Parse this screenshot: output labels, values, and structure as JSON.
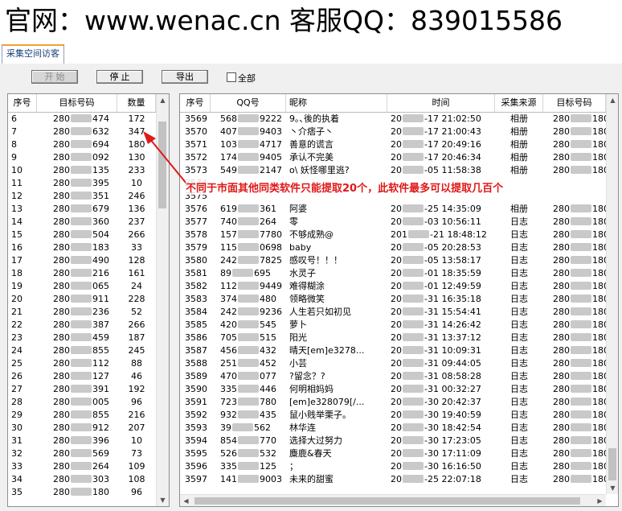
{
  "banner": "官网：www.wenac.cn  客服QQ：839015586",
  "tab_label": "采集空间访客",
  "buttons": {
    "start": "开 始",
    "stop": "停 止",
    "export": "导出"
  },
  "select_all_label": "全部",
  "annotation": "不同于市面其他同类软件只能提取20个，此软件最多可以提取几百个",
  "colors": {
    "annotation": "#e01818",
    "accent": "#f3a032"
  },
  "left_table": {
    "headers": [
      "序号",
      "目标号码",
      "数量"
    ],
    "rows": [
      [
        "6",
        "280|474",
        "172"
      ],
      [
        "7",
        "280|632",
        "347"
      ],
      [
        "8",
        "280|694",
        "180"
      ],
      [
        "9",
        "280|092",
        "130"
      ],
      [
        "10",
        "280|135",
        "233"
      ],
      [
        "11",
        "280|395",
        "10"
      ],
      [
        "12",
        "280|351",
        "246"
      ],
      [
        "13",
        "280|679",
        "136"
      ],
      [
        "14",
        "280|360",
        "237"
      ],
      [
        "15",
        "280|504",
        "266"
      ],
      [
        "16",
        "280|183",
        "33"
      ],
      [
        "17",
        "280|490",
        "128"
      ],
      [
        "18",
        "280|216",
        "161"
      ],
      [
        "19",
        "280|065",
        "24"
      ],
      [
        "20",
        "280|911",
        "228"
      ],
      [
        "21",
        "280|236",
        "52"
      ],
      [
        "22",
        "280|387",
        "266"
      ],
      [
        "23",
        "280|459",
        "187"
      ],
      [
        "24",
        "280|855",
        "245"
      ],
      [
        "25",
        "280|112",
        "88"
      ],
      [
        "26",
        "280|127",
        "46"
      ],
      [
        "27",
        "280|391",
        "192"
      ],
      [
        "28",
        "280|005",
        "96"
      ],
      [
        "29",
        "280|855",
        "216"
      ],
      [
        "30",
        "280|912",
        "207"
      ],
      [
        "31",
        "280|396",
        "10"
      ],
      [
        "32",
        "280|569",
        "73"
      ],
      [
        "33",
        "280|264",
        "109"
      ],
      [
        "34",
        "280|303",
        "108"
      ],
      [
        "35",
        "280|180",
        "96"
      ]
    ]
  },
  "right_table": {
    "headers": [
      "序号",
      "QQ号",
      "昵称",
      "时间",
      "采集来源",
      "目标号码"
    ],
    "rows": [
      [
        "3569",
        "568|9222",
        "9｡､後的执着",
        "20|-17 21:02:50",
        "相册",
        "280|180"
      ],
      [
        "3570",
        "407|9403",
        "丶介痞子丶",
        "20|-17 21:00:43",
        "相册",
        "280|180"
      ],
      [
        "3571",
        "103|4717",
        "善意的谎言",
        "20|-17 20:49:16",
        "相册",
        "280|180"
      ],
      [
        "3572",
        "174|9405",
        "承认不完美",
        "20|-17 20:46:34",
        "相册",
        "280|180"
      ],
      [
        "3573",
        "549|2147",
        "o\\ 妖怪哪里逃?",
        "20|-05 11:58:38",
        "相册",
        "280|180"
      ],
      [
        "3574",
        "",
        "",
        "",
        "",
        ""
      ],
      [
        "3575",
        "",
        "",
        "",
        "",
        ""
      ],
      [
        "3576",
        "619|361",
        "阿婆",
        "20|-25 14:35:09",
        "相册",
        "280|180"
      ],
      [
        "3577",
        "740|264",
        "零",
        "20|-03 10:56:11",
        "日志",
        "280|180"
      ],
      [
        "3578",
        "157|7780",
        "不够成熟@",
        "201|-21 18:48:12",
        "日志",
        "280|180"
      ],
      [
        "3579",
        "115|0698",
        "baby",
        "20|-05 20:28:53",
        "日志",
        "280|180"
      ],
      [
        "3580",
        "242|7825",
        "感叹号！！！",
        "20|-05 13:58:17",
        "日志",
        "280|180"
      ],
      [
        "3581",
        "89|695",
        "水灵子",
        "20|-01 18:35:59",
        "日志",
        "280|180"
      ],
      [
        "3582",
        "112|9449",
        "难得糊涂",
        "20|-01 12:49:59",
        "日志",
        "280|180"
      ],
      [
        "3583",
        "374|480",
        "领略微笑",
        "20|-31 16:35:18",
        "日志",
        "280|180"
      ],
      [
        "3584",
        "242|9236",
        "人生若只如初见",
        "20|-31 15:54:41",
        "日志",
        "280|180"
      ],
      [
        "3585",
        "420|545",
        "萝卜",
        "20|-31 14:26:42",
        "日志",
        "280|180"
      ],
      [
        "3586",
        "705|515",
        "阳光",
        "20|-31 13:37:12",
        "日志",
        "280|180"
      ],
      [
        "3587",
        "456|432",
        "晴天[em]e3278...",
        "20|-31 10:09:31",
        "日志",
        "280|180"
      ],
      [
        "3588",
        "251|452",
        "小芸",
        "20|-31 09:44:05",
        "日志",
        "280|180"
      ],
      [
        "3589",
        "470|077",
        "?留念？?",
        "20|-31 08:58:28",
        "日志",
        "280|180"
      ],
      [
        "3590",
        "335|446",
        "何明相妈妈",
        "20|-31 00:32:27",
        "日志",
        "280|180"
      ],
      [
        "3591",
        "723|780",
        "[em]e328079[/...",
        "20|-30 20:42:37",
        "日志",
        "280|180"
      ],
      [
        "3592",
        "932|435",
        "鼠小贱举栗子。",
        "20|-30 19:40:59",
        "日志",
        "280|180"
      ],
      [
        "3593",
        "39|562",
        "林华连",
        "20|-30 18:42:54",
        "日志",
        "280|180"
      ],
      [
        "3594",
        "854|770",
        "选择大过努力",
        "20|-30 17:23:05",
        "日志",
        "280|180"
      ],
      [
        "3595",
        "526|532",
        "麋鹿&春天",
        "20|-30 17:11:09",
        "日志",
        "280|180"
      ],
      [
        "3596",
        "335|125",
        "；",
        "20|-30 16:16:50",
        "日志",
        "280|180"
      ],
      [
        "3597",
        "141|9003",
        "未来的甜蜜",
        "20|-25 22:07:18",
        "日志",
        "280|180"
      ]
    ]
  }
}
